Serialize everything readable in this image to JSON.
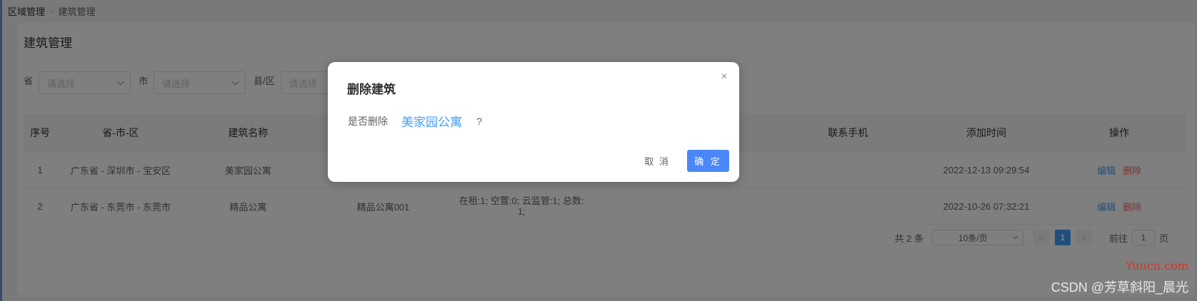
{
  "breadcrumb": {
    "parent": "区域管理",
    "separator": ">",
    "current": "建筑管理"
  },
  "page_title": "建筑管理",
  "filters": [
    {
      "label": "省",
      "placeholder": "请选择"
    },
    {
      "label": "市",
      "placeholder": "请选择"
    },
    {
      "label": "县/区",
      "placeholder": "请选择"
    }
  ],
  "table": {
    "columns": {
      "index": "序号",
      "region": "省-市-区",
      "name": "建筑名称",
      "phone": "联系手机",
      "time": "添加时间",
      "actions": "操作"
    },
    "rows": [
      {
        "index": "1",
        "region": "广东省 - 深圳市 - 宝安区",
        "name": "美家园公寓",
        "code": "",
        "status_line1": "",
        "status_line2": "",
        "time": "2022-12-13 09:29:54",
        "edit": "编辑",
        "delete": "删除"
      },
      {
        "index": "2",
        "region": "广东省 - 东莞市 - 东莞市",
        "name": "精品公寓",
        "code": "精品公寓001",
        "status_line1": "在租:1; 空置:0; 云监管:1; 总数:",
        "status_line2": "1;",
        "time": "2022-10-26 07:32:21",
        "edit": "编辑",
        "delete": "删除"
      }
    ]
  },
  "pagination": {
    "total": "共 2 条",
    "page_size": "10条/页",
    "prev": "<",
    "current_page": "1",
    "next": ">",
    "goto_label": "前往",
    "goto_value": "1",
    "page_suffix": "页"
  },
  "dialog": {
    "title": "删除建筑",
    "close": "×",
    "prompt": "是否删除",
    "target": "美家园公寓",
    "question_mark": "?",
    "cancel": "取 消",
    "confirm": "确 定"
  },
  "watermarks": {
    "site": "Yuucn.com",
    "author": "CSDN @芳草斜阳_晨光"
  },
  "colors": {
    "primary": "#409eff",
    "danger": "#f56c6c",
    "confirm_button": "#4b87f6"
  }
}
